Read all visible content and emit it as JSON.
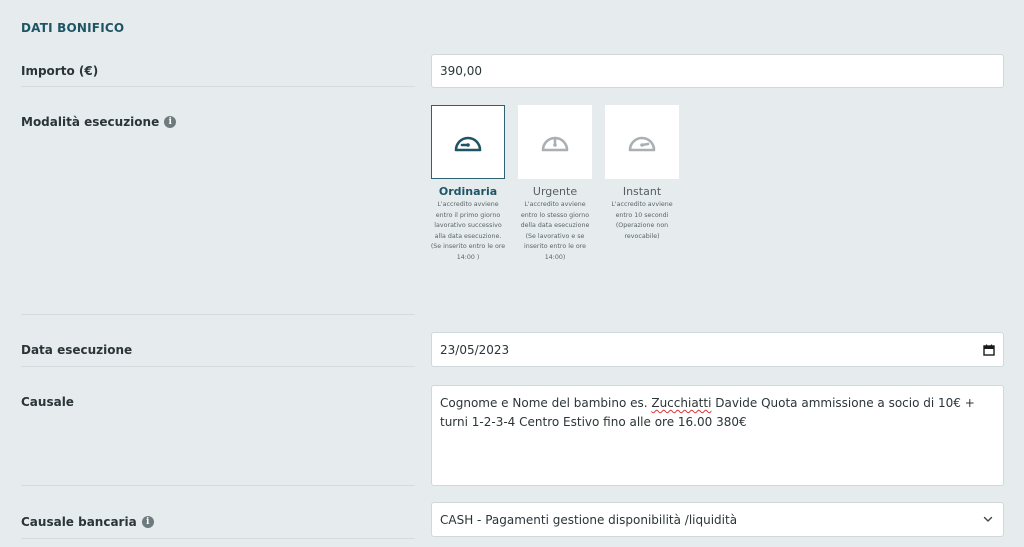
{
  "section": {
    "title": "DATI BONIFICO"
  },
  "importo": {
    "label": "Importo (€)",
    "value": "390,00"
  },
  "modalita": {
    "label": "Modalità esecuzione",
    "info_icon": "info-icon",
    "options": [
      {
        "title": "Ordinaria",
        "selected": true,
        "icon": "speedometer-slow-icon",
        "desc": [
          "L'accredito avviene",
          "entro il primo giorno",
          "lavorativo successivo",
          "alla data esecuzione.",
          "(Se inserito entro le ore",
          "14:00 )"
        ]
      },
      {
        "title": "Urgente",
        "selected": false,
        "icon": "speedometer-medium-icon",
        "desc": [
          "L'accredito avviene",
          "entro lo stesso giorno",
          "della data esecuzione",
          "(Se lavorativo e se",
          "inserito entro le ore",
          "14:00)"
        ]
      },
      {
        "title": "Instant",
        "selected": false,
        "icon": "speedometer-fast-icon",
        "desc": [
          "L'accredito avviene",
          "entro 10 secondi",
          "(Operazione non",
          "revocabile)"
        ]
      }
    ]
  },
  "data_esecuzione": {
    "label": "Data esecuzione",
    "value": "23/05/2023",
    "icon": "calendar-icon"
  },
  "causale": {
    "label": "Causale",
    "value_before": "Cognome e Nome del bambino es. ",
    "value_misspelled": "Zucchiatti",
    "value_after": " Davide Quota ammissione a socio di 10€ + turni 1-2-3-4 Centro Estivo fino alle ore 16.00 380€"
  },
  "causale_bancaria": {
    "label": "Causale bancaria",
    "info_icon": "info-icon",
    "value": "CASH - Pagamenti gestione disponibilità /liquidità",
    "icon": "chevron-down-icon"
  },
  "colors": {
    "accent": "#1e5565",
    "background": "#e6ecee",
    "field_border": "#cfd8db"
  }
}
